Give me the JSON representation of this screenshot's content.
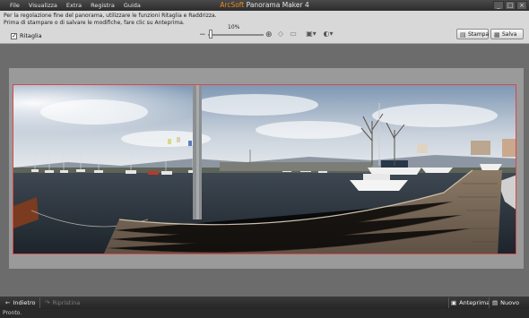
{
  "menu": [
    "File",
    "Visualizza",
    "Extra",
    "Registra",
    "Guida"
  ],
  "title": {
    "brand": "ArcSoft",
    "name": " Panorama Maker 4"
  },
  "window_buttons": [
    "_",
    "□",
    "×"
  ],
  "instructions": {
    "line1": "Per la regolazione fine del panorama, utilizzare le funzioni Ritaglia e Raddrizza.",
    "line2": "Prima di stampare o di salvare le modifiche, fare clic su Anteprima."
  },
  "crop": {
    "label": "Ritaglia",
    "checked": true,
    "mark": "✓"
  },
  "zoom": {
    "label": "10%",
    "value_percent": 10
  },
  "toolbar": {
    "print": "Stampa",
    "save": "Salva"
  },
  "bottom": {
    "back": "Indietro",
    "redo": "Ripristina",
    "preview": "Anteprima",
    "new": "Nuovo"
  },
  "status": "Pronto.",
  "icons": {
    "back": "back-arrow-icon",
    "redo": "redo-icon",
    "preview": "preview-icon",
    "new": "new-icon",
    "print": "printer-icon",
    "save": "save-icon"
  },
  "colors": {
    "accent": "#f08a24",
    "crop_border": "#d64a4a"
  }
}
